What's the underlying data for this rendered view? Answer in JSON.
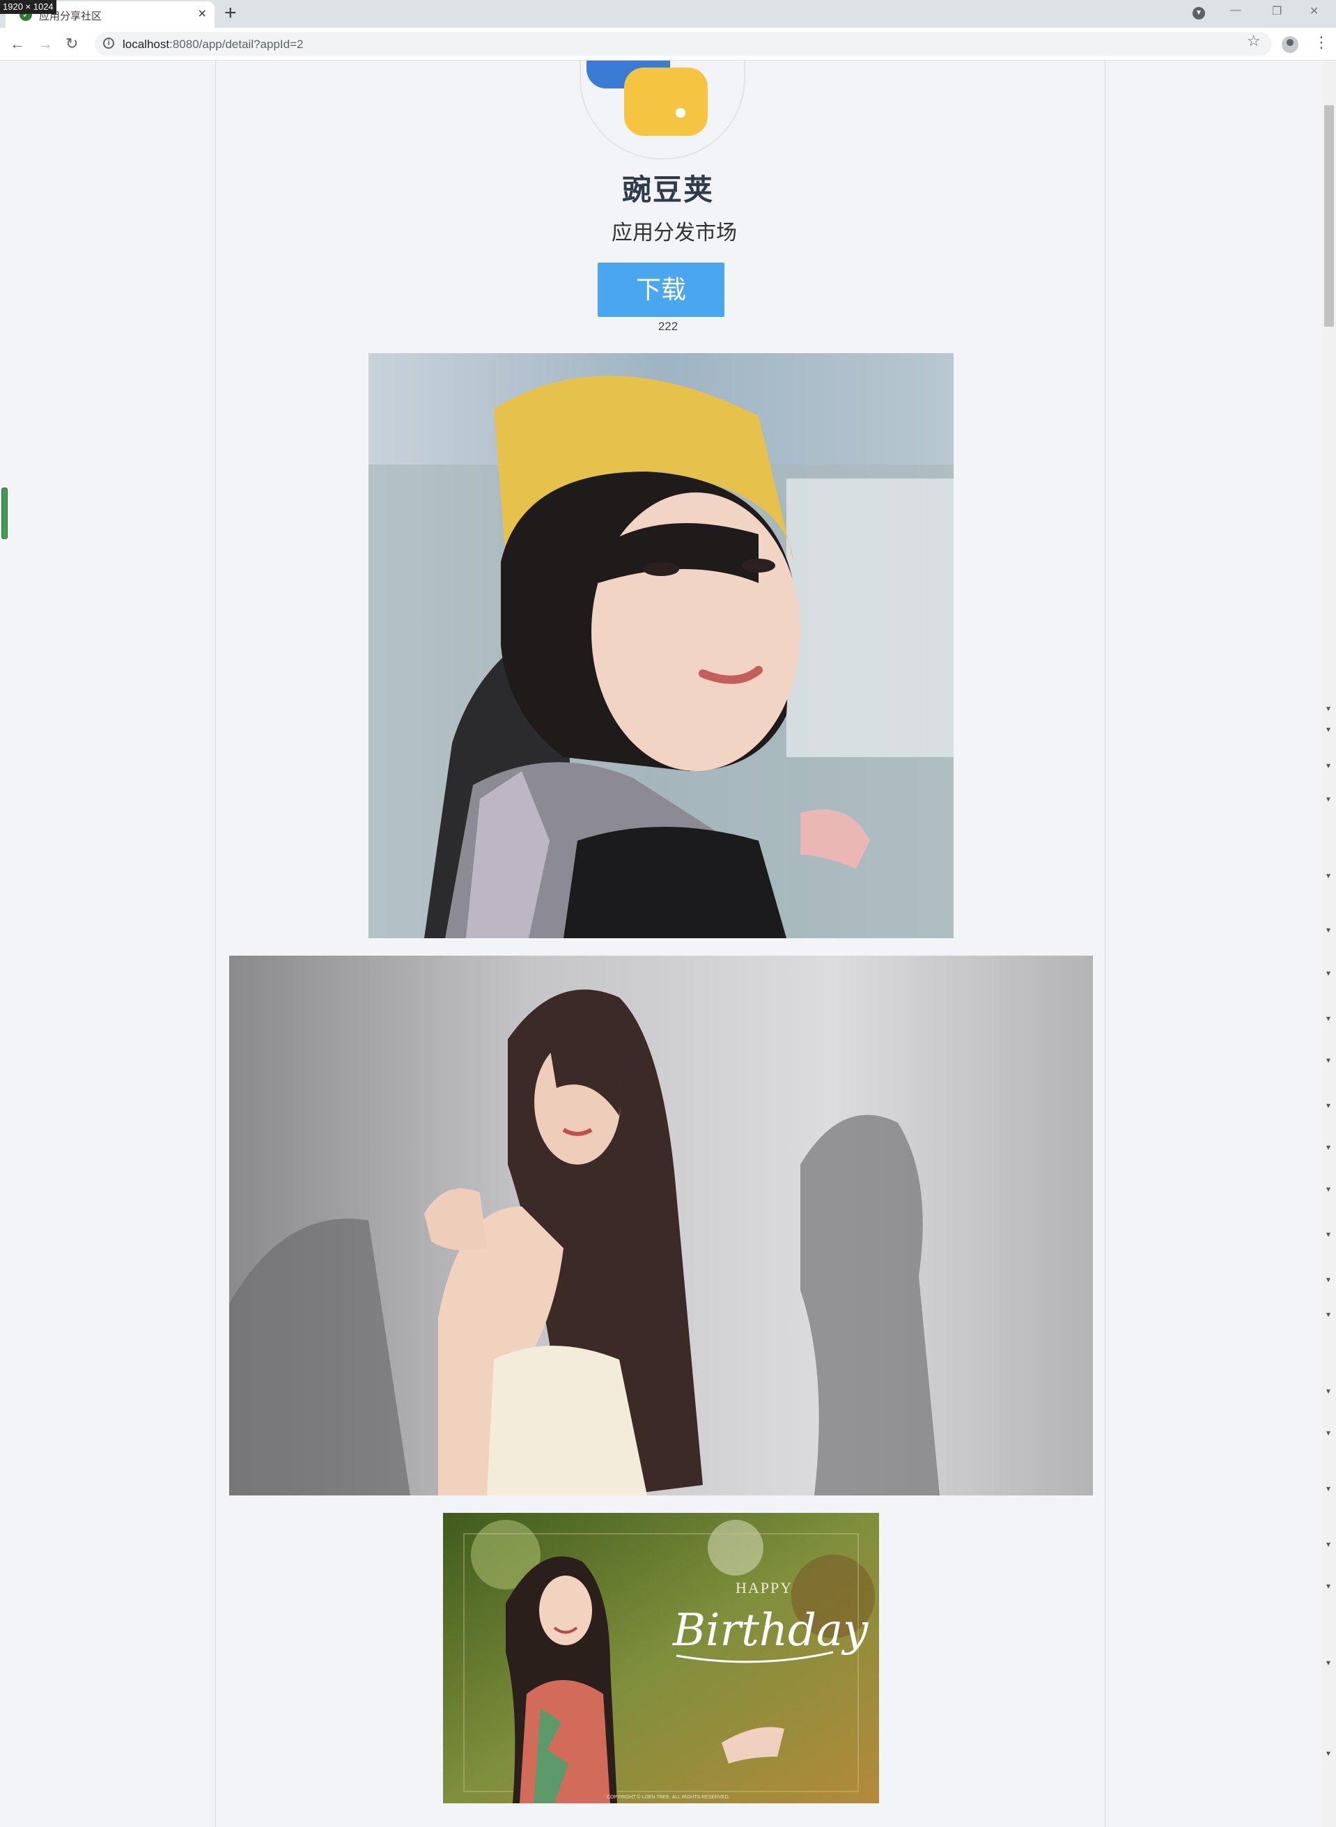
{
  "browser": {
    "resolution_badge": "1920 × 1024",
    "tab_title": "应用分享社区",
    "url_host": "localhost",
    "url_path": ":8080/app/detail?appId=2"
  },
  "app": {
    "name": "豌豆荚",
    "description": "应用分发市场",
    "download_label": "下载",
    "download_count": "222"
  },
  "photos": [
    {
      "name": "photo-girl-yellow-beanie"
    },
    {
      "name": "photo-girl-long-hair"
    },
    {
      "name": "photo-birthday-card",
      "overlay_small": "HAPPY",
      "overlay_big": "Birthday",
      "footer": "COPYRIGHT © LOEN TREE. ALL RIGHTS RESERVED."
    }
  ]
}
